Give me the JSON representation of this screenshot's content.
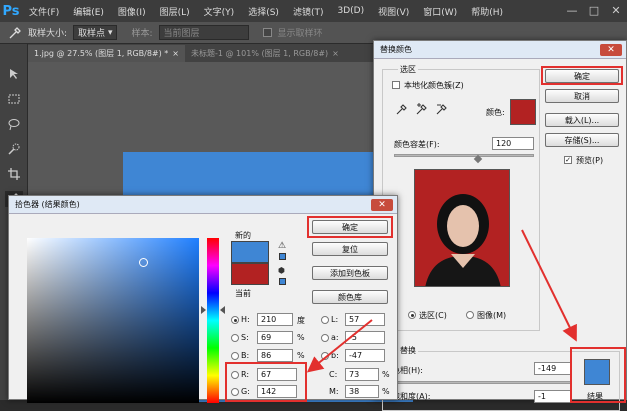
{
  "app": {
    "logo": "Ps",
    "menu": [
      "文件(F)",
      "编辑(E)",
      "图像(I)",
      "图层(L)",
      "文字(Y)",
      "选择(S)",
      "滤镜(T)",
      "3D(D)",
      "视图(V)",
      "窗口(W)",
      "帮助(H)"
    ],
    "window_controls": [
      "—",
      "□",
      "✕"
    ]
  },
  "options_bar": {
    "sample_size_label": "取样大小:",
    "sample_size_value": "取样点",
    "sample_label": "样本:",
    "sample_value": "当前图层",
    "show_ring_label": "显示取样环"
  },
  "tabs": [
    {
      "label": "1.jpg @ 27.5% (图层 1, RGB/8#) *",
      "close": "×"
    },
    {
      "label": "未标题-1 @ 101% (图层 1, RGB/8#)",
      "close": "×"
    }
  ],
  "replace_dialog": {
    "title": "替换颜色",
    "selection_group": "选区",
    "localized_clusters": "本地化颜色簇(Z)",
    "color_label": "颜色:",
    "fuzziness_label": "颜色容差(F):",
    "fuzziness_value": "120",
    "radio_selection": "选区(C)",
    "radio_image": "图像(M)",
    "replace_group": "替换",
    "hue_label": "色相(H):",
    "hue_value": "-149",
    "saturation_label": "饱和度(A):",
    "saturation_value": "-1",
    "result_label": "结果",
    "ok": "确定",
    "cancel": "取消",
    "load": "载入(L)...",
    "save": "存储(S)...",
    "preview": "预览(P)",
    "sample_color": "#b22222",
    "result_color": "#3f86d4"
  },
  "picker_dialog": {
    "title": "拾色器 (结果颜色)",
    "new_label": "新的",
    "current_label": "当前",
    "new_color": "#3f86d4",
    "current_color": "#b22222",
    "ok": "确定",
    "reset": "复位",
    "add_swatch": "添加到色板",
    "color_libraries": "颜色库",
    "h_label": "H:",
    "h_value": "210",
    "h_unit": "度",
    "s_label": "S:",
    "s_value": "69",
    "s_unit": "%",
    "b_label": "B:",
    "b_value": "86",
    "b_unit": "%",
    "r_label": "R:",
    "r_value": "67",
    "g_label": "G:",
    "g_value": "142",
    "l_label": "L:",
    "l_value": "57",
    "a_label": "a:",
    "a_value": "-5",
    "lab_b_label": "b:",
    "lab_b_value": "-47",
    "c_label": "C:",
    "c_value": "73",
    "c_unit": "%",
    "m_label": "M:",
    "m_value": "38",
    "m_unit": "%"
  },
  "colors": {
    "annotation_red": "#e2302e",
    "ps_blue": "#31a8ff"
  }
}
